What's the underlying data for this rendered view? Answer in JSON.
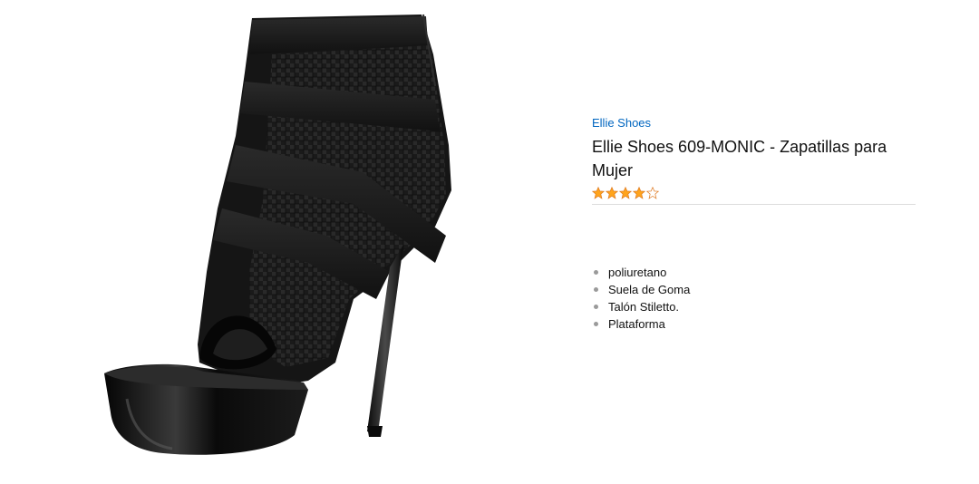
{
  "product": {
    "image_alt": "Ellie Shoes 609-MONIC black peep-toe platform stiletto ankle bootie",
    "brand": "Ellie Shoes",
    "title": "Ellie Shoes 609-MONIC - Zapatillas para Mujer",
    "rating": {
      "stars": 4,
      "max": 5,
      "filled_color": "#ffa41c",
      "empty_color": "#ffffff",
      "outline_color": "#de7921"
    },
    "features": [
      "poliuretano",
      "Suela de Goma",
      "Talón Stiletto.",
      "Plataforma"
    ]
  },
  "colors": {
    "link": "#0066c0",
    "text": "#111111",
    "divider": "#dddddd",
    "bullet": "#9a9a9a"
  }
}
